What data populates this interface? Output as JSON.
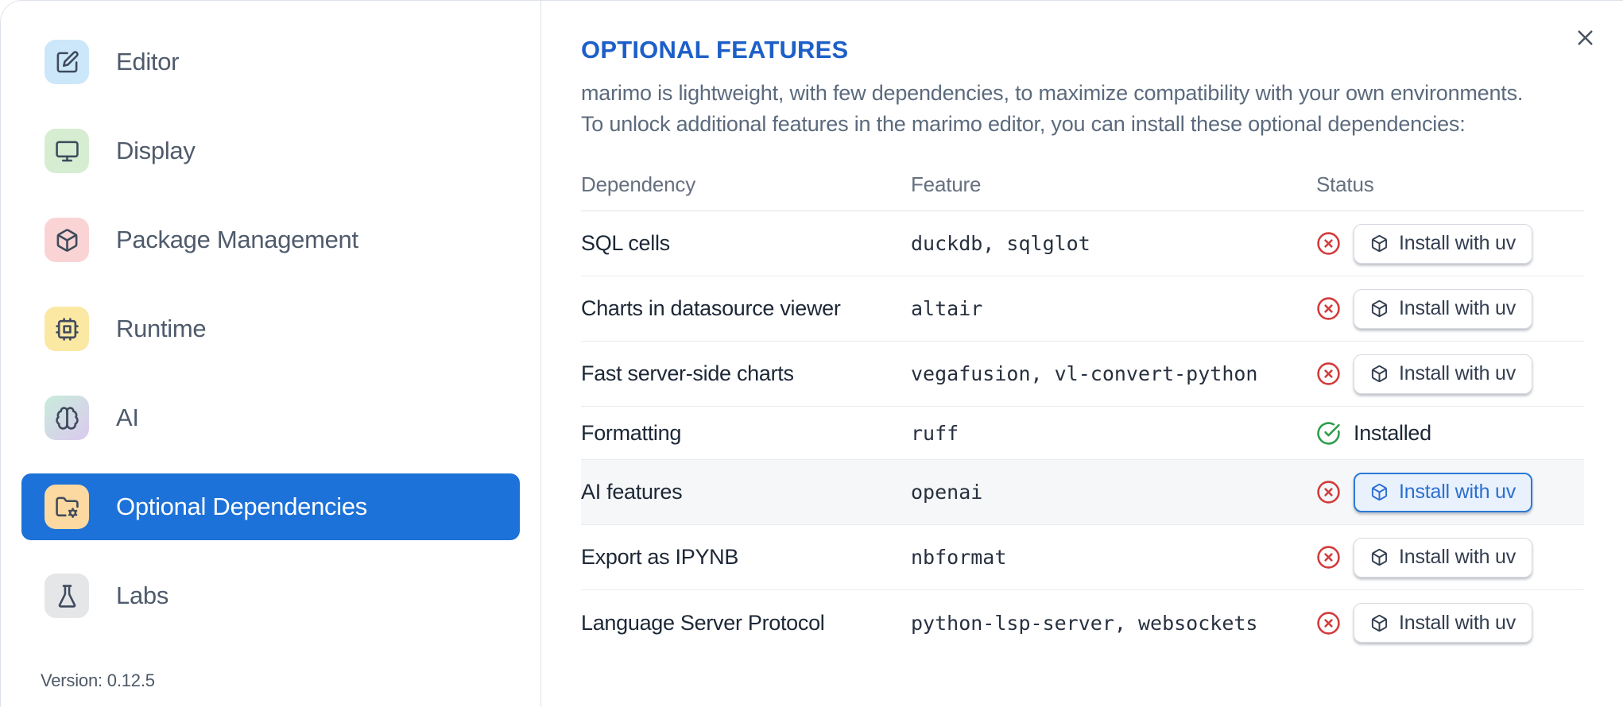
{
  "sidebar": {
    "items": [
      {
        "label": "Editor",
        "icon": "edit",
        "icon_bg": "#cde7fa",
        "selected": false
      },
      {
        "label": "Display",
        "icon": "monitor",
        "icon_bg": "#d6edd2",
        "selected": false
      },
      {
        "label": "Package Management",
        "icon": "package",
        "icon_bg": "#fad4d4",
        "selected": false
      },
      {
        "label": "Runtime",
        "icon": "cpu",
        "icon_bg": "#fbe8a3",
        "selected": false
      },
      {
        "label": "AI",
        "icon": "brain",
        "icon_bg": "linear-gradient(140deg,#c8ecdb,#dbc9ef)",
        "selected": false
      },
      {
        "label": "Optional Dependencies",
        "icon": "folder-cog",
        "icon_bg": "#fdd9a2",
        "selected": true
      },
      {
        "label": "Labs",
        "icon": "flask",
        "icon_bg": "#e5e6e8",
        "selected": false
      }
    ],
    "version_label": "Version: 0.12.5"
  },
  "panel": {
    "title": "OPTIONAL FEATURES",
    "description_line1": "marimo is lightweight, with few dependencies, to maximize compatibility with your own environments.",
    "description_line2": "To unlock additional features in the marimo editor, you can install these optional dependencies:",
    "table": {
      "headers": [
        "Dependency",
        "Feature",
        "Status"
      ],
      "rows": [
        {
          "dependency": "SQL cells",
          "feature": "duckdb, sqlglot",
          "installed": false,
          "action_label": "Install with uv",
          "highlighted": false
        },
        {
          "dependency": "Charts in datasource viewer",
          "feature": "altair",
          "installed": false,
          "action_label": "Install with uv",
          "highlighted": false
        },
        {
          "dependency": "Fast server-side charts",
          "feature": "vegafusion, vl-convert-python",
          "installed": false,
          "action_label": "Install with uv",
          "highlighted": false
        },
        {
          "dependency": "Formatting",
          "feature": "ruff",
          "installed": true,
          "status_label": "Installed",
          "highlighted": false
        },
        {
          "dependency": "AI features",
          "feature": "openai",
          "installed": false,
          "action_label": "Install with uv",
          "highlighted": true
        },
        {
          "dependency": "Export as IPYNB",
          "feature": "nbformat",
          "installed": false,
          "action_label": "Install with uv",
          "highlighted": false
        },
        {
          "dependency": "Language Server Protocol",
          "feature": "python-lsp-server, websockets",
          "installed": false,
          "action_label": "Install with uv",
          "highlighted": false
        }
      ]
    }
  },
  "colors": {
    "selected_item_bg": "#1c72d8",
    "title_blue": "#1d5fc8",
    "status_error_red": "#d33b3b",
    "status_ok_green": "#2f9e4d",
    "focused_button_border": "#2b7ad6",
    "focused_button_bg": "#e9f1fd",
    "focused_button_text": "#2b6fd0",
    "highlight_row_bg": "#f6f7f8"
  }
}
